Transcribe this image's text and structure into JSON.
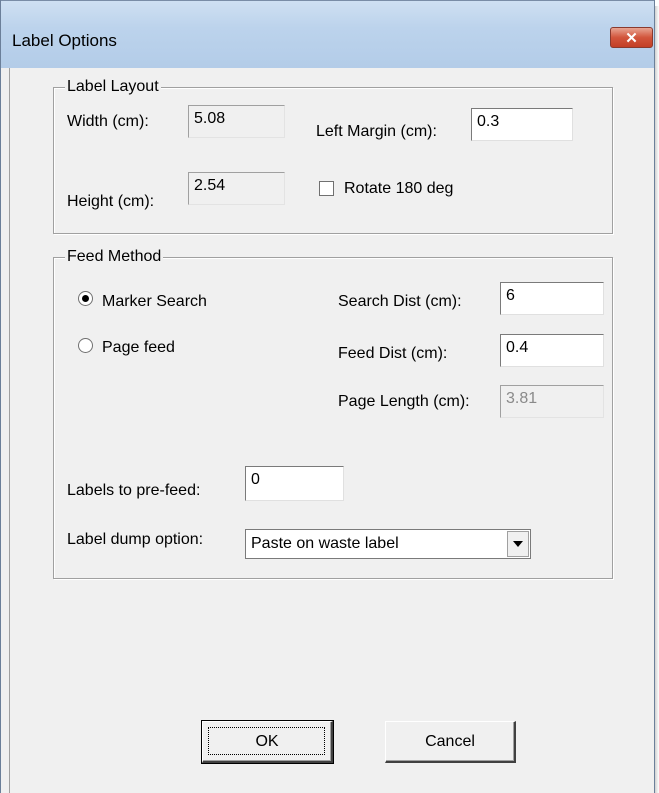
{
  "window": {
    "title": "Label Options",
    "close_glyph": "✕"
  },
  "label_layout": {
    "group_title": "Label Layout",
    "width_label": "Width (cm):",
    "width_value": "5.08",
    "height_label": "Height (cm):",
    "height_value": "2.54",
    "left_margin_label": "Left Margin (cm):",
    "left_margin_value": "0.3",
    "rotate_label": "Rotate 180 deg",
    "rotate_checked": false
  },
  "feed_method": {
    "group_title": "Feed Method",
    "marker_search_label": "Marker Search",
    "marker_search_selected": true,
    "page_feed_label": "Page feed",
    "page_feed_selected": false,
    "search_dist_label": "Search Dist (cm):",
    "search_dist_value": "6",
    "feed_dist_label": "Feed Dist (cm):",
    "feed_dist_value": "0.4",
    "page_length_label": "Page Length (cm):",
    "page_length_value": "3.81",
    "prefeed_label": "Labels to pre-feed:",
    "prefeed_value": "0",
    "dump_label": "Label dump option:",
    "dump_value": "Paste on waste label"
  },
  "buttons": {
    "ok": "OK",
    "cancel": "Cancel"
  },
  "icons": {
    "close": "close-icon",
    "dropdown": "chevron-down-icon"
  }
}
